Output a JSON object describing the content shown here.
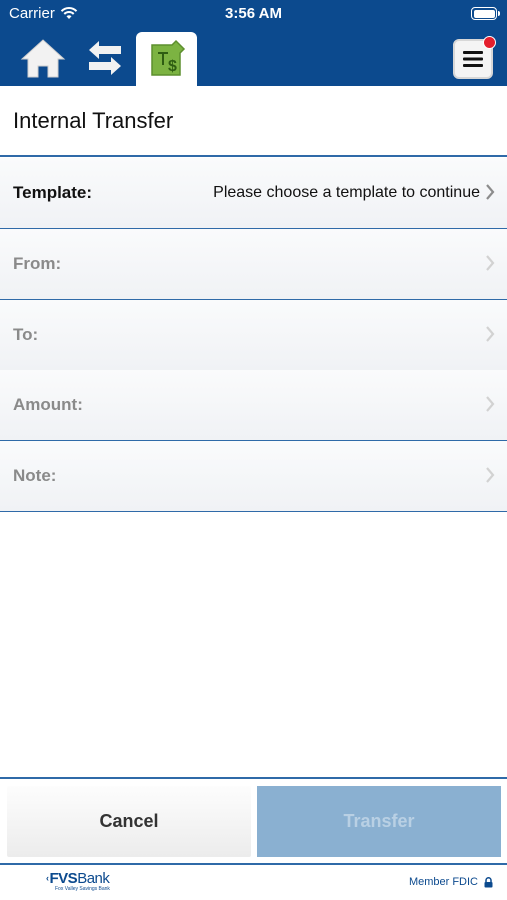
{
  "status_bar": {
    "carrier": "Carrier",
    "time": "3:56 AM"
  },
  "nav": {
    "icons": [
      "home-icon",
      "transfer-arrows-icon",
      "internal-transfer-icon",
      "menu-icon"
    ],
    "accent": "#0c4a8e",
    "badge_color": "#e41f2d"
  },
  "page": {
    "title": "Internal Transfer"
  },
  "form": {
    "template_label": "Template:",
    "template_value": "Please choose a template to continue",
    "from_label": "From:",
    "to_label": "To:",
    "amount_label": "Amount:",
    "note_label": "Note:"
  },
  "actions": {
    "cancel_label": "Cancel",
    "transfer_label": "Transfer"
  },
  "footer": {
    "brand_name": "FVS",
    "brand_suffix": "Bank",
    "brand_tagline": "Fox Valley Savings Bank",
    "fdic_text": "Member FDIC"
  }
}
